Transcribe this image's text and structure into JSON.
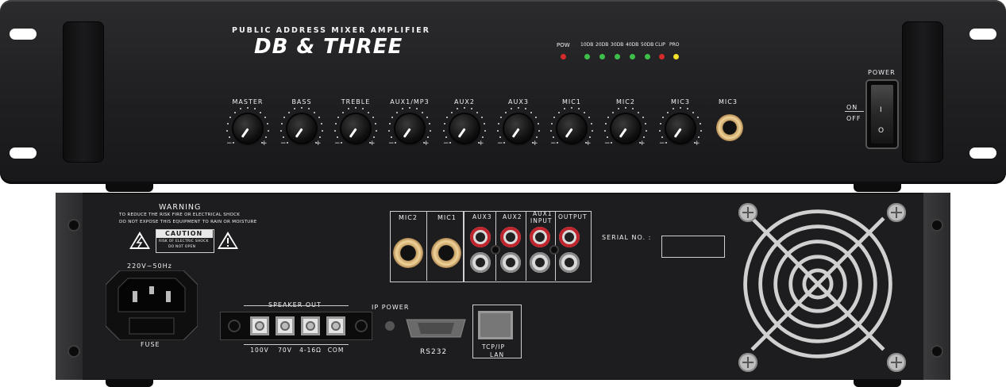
{
  "front": {
    "subtitle": "PUBLIC ADDRESS MIXER AMPLIFIER",
    "brand": "DB & THREE",
    "leds": {
      "pow_label": "POW",
      "labels": [
        "10DB",
        "20DB",
        "30DB",
        "40DB",
        "50DB",
        "CLIP",
        "PRO"
      ],
      "colors": [
        "#3fbf4a",
        "#3fbf4a",
        "#3fbf4a",
        "#3fbf4a",
        "#3fbf4a",
        "#d62a2a",
        "#f3e12b"
      ],
      "pow_color": "#d62a2a"
    },
    "knobs": [
      "MASTER",
      "BASS",
      "TREBLE",
      "AUX1/MP3",
      "AUX2",
      "AUX3",
      "MIC1",
      "MIC2",
      "MIC3"
    ],
    "minus": "−",
    "plus": "+",
    "mic_jack_label": "MIC3",
    "power": {
      "label": "POWER",
      "on": "ON",
      "off": "OFF",
      "i": "I",
      "o": "O"
    }
  },
  "rear": {
    "warning_title": "WARNING",
    "warning_line1": "TO REDUCE THE RISK FIRE OR ELECTRICAL SHOCK",
    "warning_line2": "DO NOT EXPOSE THIS EQUIPMENT TO RAIN OR MOISTURE",
    "caution": "CAUTION",
    "caution_line1": "RISK OF ELECTRIC SHOCK",
    "caution_line2": "DO NOT OPEN",
    "power_rating": "220V~50Hz",
    "fuse": "FUSE",
    "mic_labels": [
      "MIC2",
      "MIC1"
    ],
    "rca_labels": {
      "aux3": "AUX3",
      "aux2": "AUX2",
      "aux1": "AUX1",
      "aux1_sub": "INPUT",
      "output": "OUTPUT"
    },
    "serial_label": "SERIAL NO. :",
    "speaker_out": "SPEAKER OUT",
    "speaker_taps": [
      "100V",
      "70V",
      "4-16Ω",
      "COM"
    ],
    "ip_power": "IP POWER",
    "rs232": "RS232",
    "lan_top": "TCP/IP",
    "lan_bottom": "LAN"
  }
}
